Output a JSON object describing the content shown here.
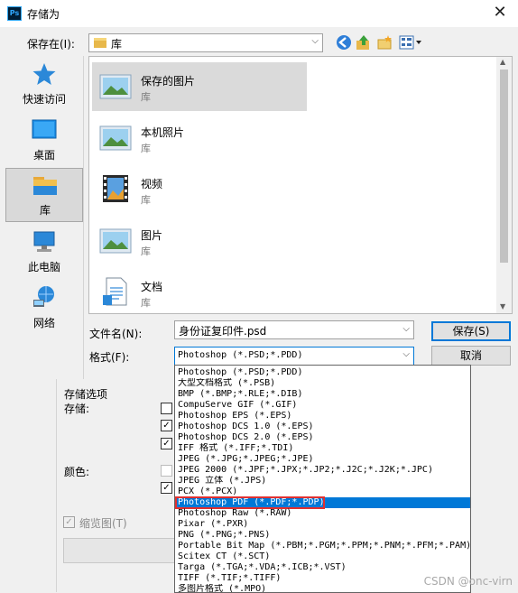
{
  "window": {
    "title": "存储为",
    "app_icon_text": "Ps"
  },
  "location": {
    "label": "保存在(I):",
    "value": "库"
  },
  "places": [
    {
      "label": "快速访问",
      "icon": "star-icon",
      "selected": false
    },
    {
      "label": "桌面",
      "icon": "desktop-icon",
      "selected": false
    },
    {
      "label": "库",
      "icon": "library-folder-icon",
      "selected": true
    },
    {
      "label": "此电脑",
      "icon": "computer-icon",
      "selected": false
    },
    {
      "label": "网络",
      "icon": "network-globe-icon",
      "selected": false
    }
  ],
  "files": [
    {
      "name": "保存的图片",
      "sub": "库",
      "icon": "picture-library-icon",
      "selected": true
    },
    {
      "name": "本机照片",
      "sub": "库",
      "icon": "picture-library-icon",
      "selected": false
    },
    {
      "name": "视频",
      "sub": "库",
      "icon": "video-library-icon",
      "selected": false
    },
    {
      "name": "图片",
      "sub": "库",
      "icon": "picture-library-icon",
      "selected": false
    },
    {
      "name": "文档",
      "sub": "库",
      "icon": "document-library-icon",
      "selected": false
    }
  ],
  "filename": {
    "label": "文件名(N):",
    "value": "身份证复印件.psd"
  },
  "format": {
    "label": "格式(F):",
    "value": "Photoshop (*.PSD;*.PDD)"
  },
  "buttons": {
    "save": "保存(S)",
    "cancel": "取消"
  },
  "options": {
    "group_title": "存储选项",
    "save_label": "存储:",
    "color_label": "颜色:",
    "thumbnail_label": "缩览图(T)",
    "checkboxes": [
      true,
      true,
      true,
      false,
      true
    ]
  },
  "format_options": [
    "Photoshop (*.PSD;*.PDD)",
    "大型文档格式 (*.PSB)",
    "BMP (*.BMP;*.RLE;*.DIB)",
    "CompuServe GIF (*.GIF)",
    "Photoshop EPS (*.EPS)",
    "Photoshop DCS 1.0 (*.EPS)",
    "Photoshop DCS 2.0 (*.EPS)",
    "IFF 格式 (*.IFF;*.TDI)",
    "JPEG (*.JPG;*.JPEG;*.JPE)",
    "JPEG 2000 (*.JPF;*.JPX;*.JP2;*.J2C;*.J2K;*.JPC)",
    "JPEG 立体 (*.JPS)",
    "PCX (*.PCX)",
    "Photoshop PDF (*.PDF;*.PDP)",
    "Photoshop Raw (*.RAW)",
    "Pixar (*.PXR)",
    "PNG (*.PNG;*.PNS)",
    "Portable Bit Map (*.PBM;*.PGM;*.PPM;*.PNM;*.PFM;*.PAM)",
    "Scitex CT (*.SCT)",
    "Targa (*.TGA;*.VDA;*.ICB;*.VST)",
    "TIFF (*.TIF;*.TIFF)",
    "多图片格式 (*.MPO)"
  ],
  "format_highlighted": 12,
  "watermark": "CSDN @onc-virn"
}
